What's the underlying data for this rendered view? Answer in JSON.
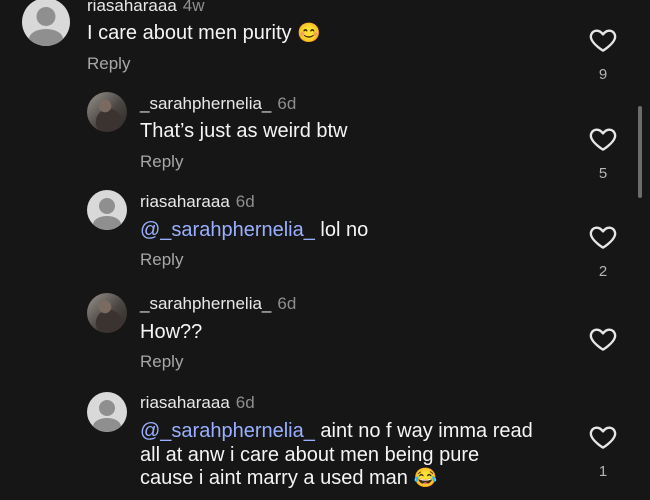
{
  "comments": [
    {
      "username": "riasaharaaa",
      "time": "4w",
      "text": "I care about men purity",
      "emoji": "😊",
      "reply": "Reply",
      "likes": "9",
      "avatar": "default-avatar"
    },
    {
      "username": "_sarahphernelia_",
      "time": "6d",
      "text": "That’s just as weird btw",
      "reply": "Reply",
      "likes": "5",
      "avatar": "photo-avatar"
    },
    {
      "username": "riasaharaaa",
      "time": "6d",
      "mention": "@_sarahphernelia_",
      "text": " lol no",
      "reply": "Reply",
      "likes": "2",
      "avatar": "default-avatar"
    },
    {
      "username": "_sarahphernelia_",
      "time": "6d",
      "text": "How??",
      "reply": "Reply",
      "likes": "",
      "avatar": "photo-avatar"
    },
    {
      "username": "riasaharaaa",
      "time": "6d",
      "mention": "@_sarahphernelia_",
      "text": " aint no f way imma read",
      "text_line2": "all at anw i care about men being pure",
      "text_line3": "cause i aint marry a used man",
      "emoji": "😂",
      "likes": "1",
      "avatar": "default-avatar"
    }
  ],
  "icons": {
    "like": "heart-outline-icon"
  },
  "colors": {
    "background": "#161616",
    "mention": "#9ab0ff",
    "secondary_text": "#a7a7a7"
  }
}
